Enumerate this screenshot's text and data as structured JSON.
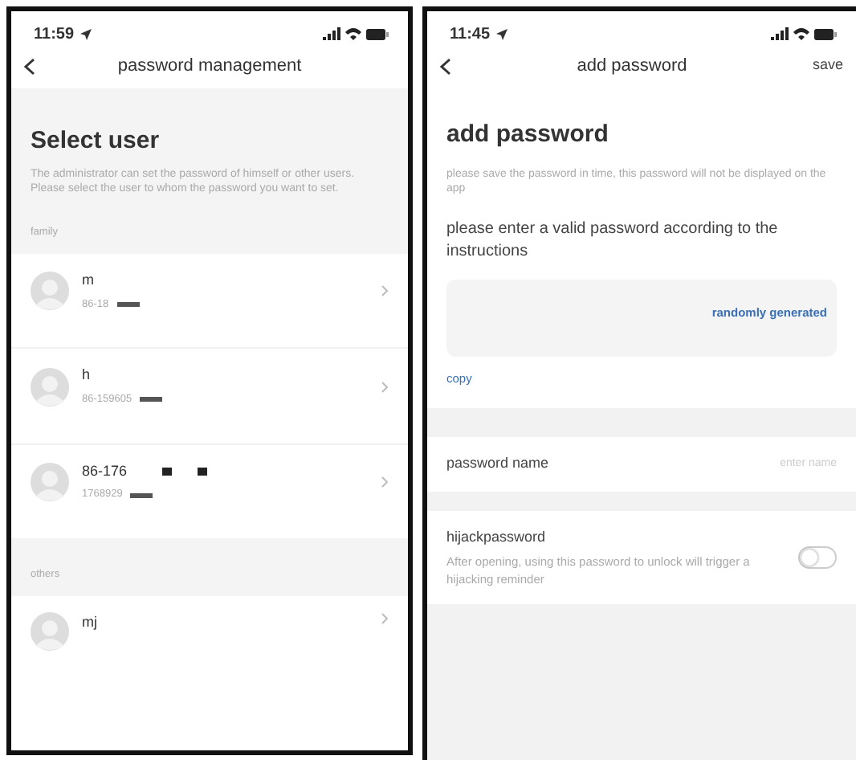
{
  "user_screen": {
    "status_bar": {
      "time": "11:59"
    },
    "nav": {
      "title": "password management"
    },
    "heading": "Select user",
    "description": "The administrator can set the password of himself or other users. Please select the user to whom the password you want to set.",
    "groups": [
      {
        "label": "family",
        "users": [
          {
            "name": "m",
            "phone": "86-18",
            "name_redacted": false,
            "phone_redacted": true
          },
          {
            "name": "h",
            "phone": "86-159605",
            "name_redacted": false,
            "phone_redacted": true
          },
          {
            "name": "86-176",
            "phone": "1768929",
            "name_redacted": true,
            "phone_redacted": true
          }
        ]
      },
      {
        "label": "others",
        "users": [
          {
            "name": "mj",
            "name_redacted": false,
            "phone_redacted": false
          }
        ]
      }
    ]
  },
  "add_screen": {
    "status_bar": {
      "time": "11:45"
    },
    "nav": {
      "title": "add password",
      "action": "save"
    },
    "heading": "add password",
    "description": "please save the password in time, this password will not be displayed on the app",
    "instruction": "please enter a valid password according to the instructions",
    "generate_link": "randomly generated",
    "copy_link": "copy",
    "name_field": {
      "label": "password name",
      "placeholder": "enter name"
    },
    "hijack": {
      "title": "hijackpassword",
      "description": "After opening, using this password to unlock will trigger a hijacking reminder",
      "on": false
    }
  }
}
